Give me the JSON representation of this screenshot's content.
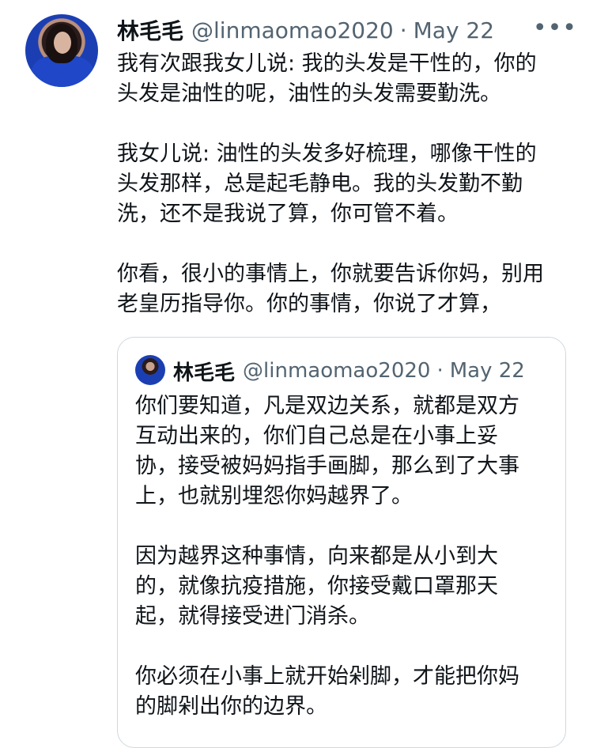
{
  "tweet": {
    "author_name": "林毛毛",
    "author_handle": "@linmaomao2020",
    "separator": "·",
    "date": "May 22",
    "more_icon": "more-horizontal-icon",
    "text": "我有次跟我女儿说: 我的头发是干性的，你的\n头发是油性的呢，油性的头发需要勤洗。\n\n我女儿说: 油性的头发多好梳理，哪像干性的\n头发那样，总是起毛静电。我的头发勤不勤\n洗，还不是我说了算，你可管不着。\n\n你看，很小的事情上，你就要告诉你妈，别用\n老皇历指导你。你的事情，你说了才算，"
  },
  "quoted_tweet": {
    "author_name": "林毛毛",
    "author_handle": "@linmaomao2020",
    "separator": "·",
    "date": "May 22",
    "text": "你们要知道，凡是双边关系，就都是双方\n互动出来的，你们自己总是在小事上妥\n协，接受被妈妈指手画脚，那么到了大事\n上，也就别埋怨你妈越界了。\n\n因为越界这种事情，向来都是从小到大\n的，就像抗疫措施，你接受戴口罩那天\n起，就得接受进门消杀。\n\n你必须在小事上就开始剁脚，才能把你妈\n的脚剁出你的边界。"
  }
}
